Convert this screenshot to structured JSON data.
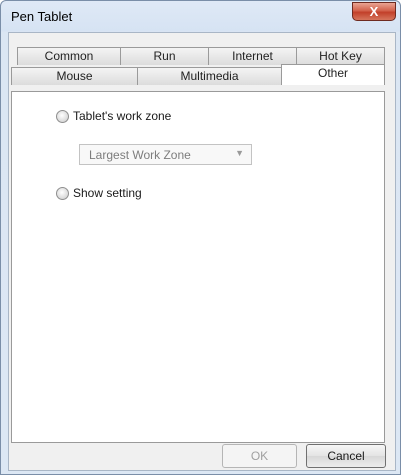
{
  "window": {
    "title": "Pen Tablet",
    "close_label": "X"
  },
  "tabs": {
    "row_back": [
      "Common",
      "Run",
      "Internet",
      "Hot Key"
    ],
    "row_front": [
      "Mouse",
      "Multimedia",
      "Other"
    ],
    "active": "Other"
  },
  "options": {
    "work_zone_label": "Tablet's work zone",
    "work_zone_value": "Largest Work Zone",
    "show_setting_label": "Show setting"
  },
  "buttons": {
    "ok": "OK",
    "cancel": "Cancel"
  }
}
